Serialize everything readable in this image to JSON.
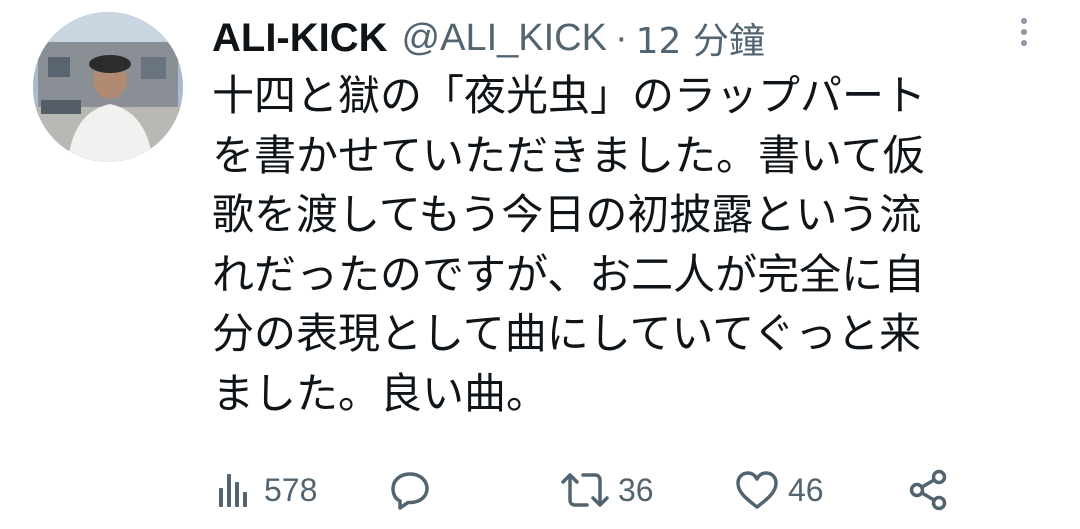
{
  "user": {
    "display_name": "ALI-KICK",
    "handle": "@ALI_KICK",
    "separator": "·",
    "time": "12 分鐘",
    "avatar_icon": "profile-photo"
  },
  "tweet": {
    "lines": [
      "十四と獄の「夜光虫」のラップパート",
      "を書かせていただきました。書いて仮",
      "歌を渡してもう今日の初披露という流",
      "れだったのですが、お二人が完全に自",
      "分の表現として曲にしていてぐっと来",
      "ました。良い曲。"
    ]
  },
  "actions": {
    "views": {
      "icon": "views-icon",
      "count": "578"
    },
    "reply": {
      "icon": "reply-icon"
    },
    "retweet": {
      "icon": "retweet-icon",
      "count": "36"
    },
    "like": {
      "icon": "like-icon",
      "count": "46"
    },
    "share": {
      "icon": "share-icon"
    }
  },
  "more_icon": "more-vertical-icon"
}
